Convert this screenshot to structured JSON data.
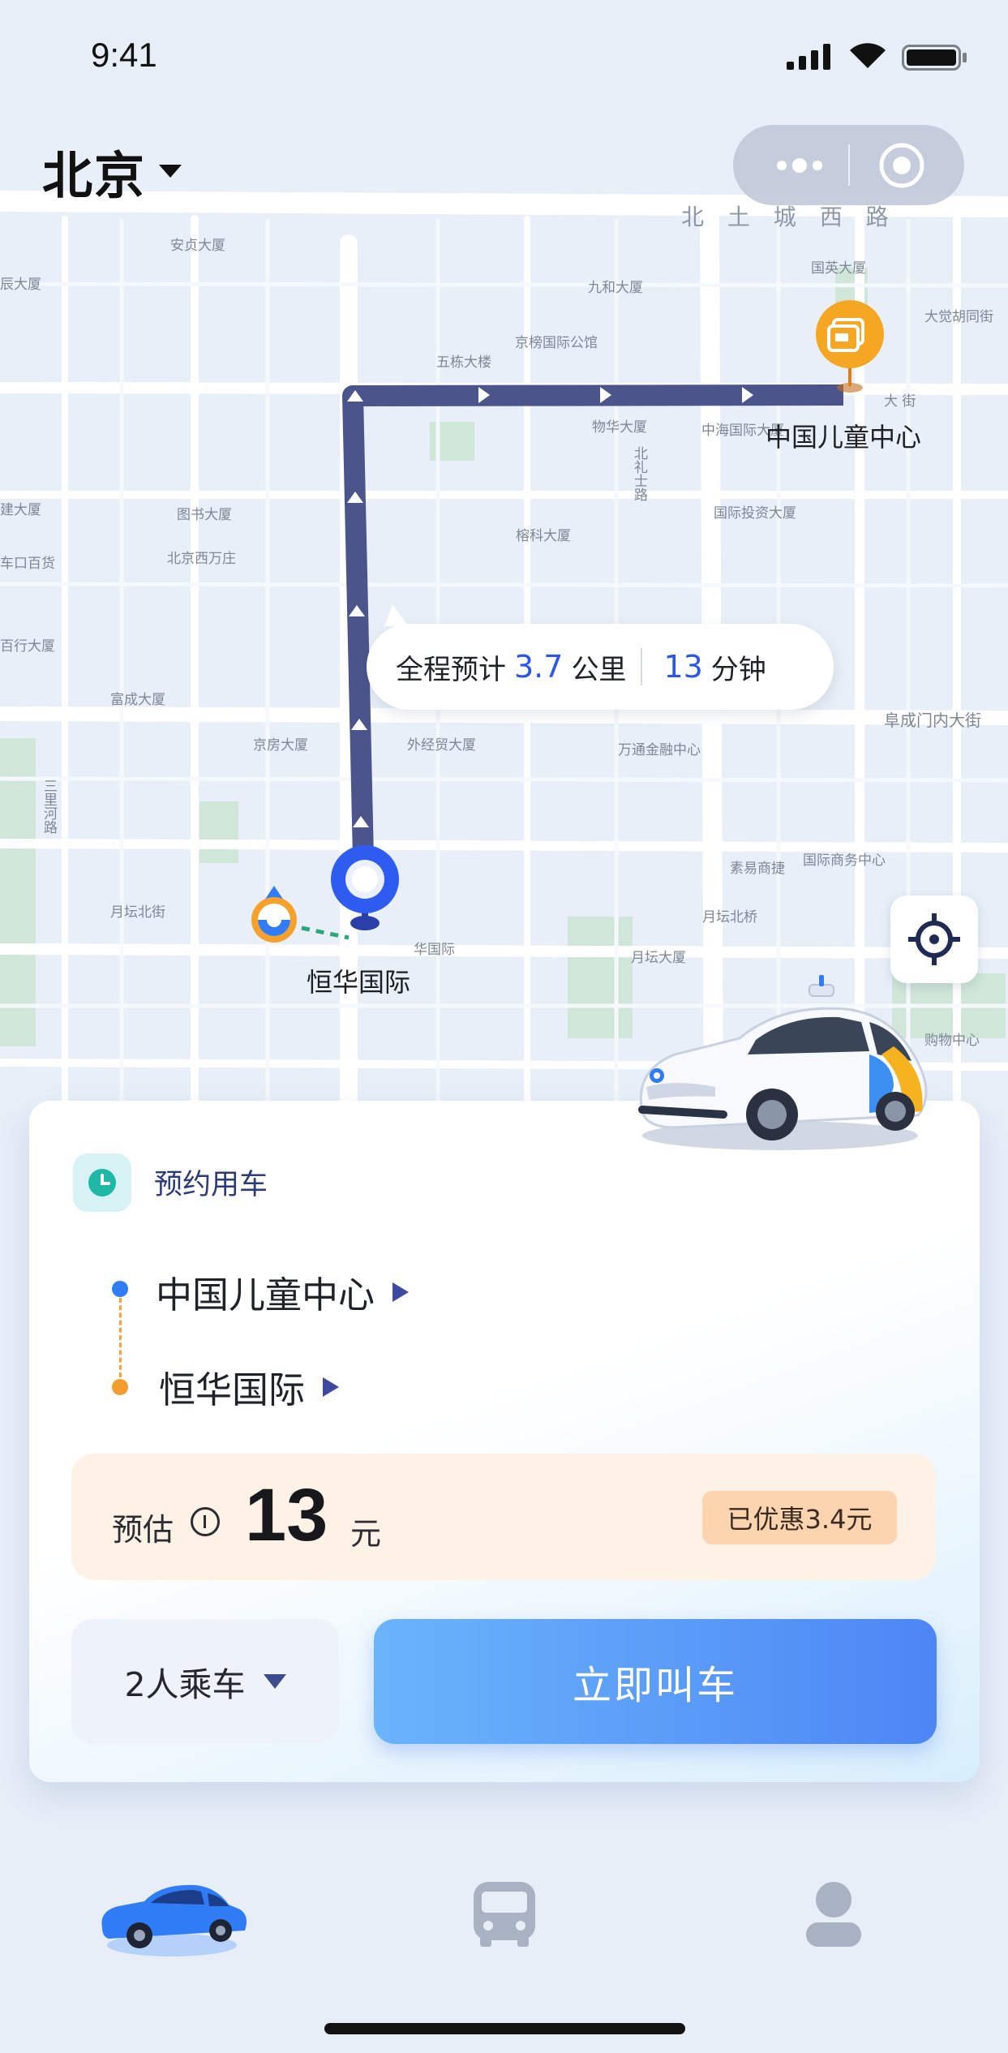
{
  "status_bar": {
    "time": "9:41"
  },
  "header": {
    "city": "北京"
  },
  "map": {
    "labels": {
      "north_road": "北 土 城 西 路",
      "anzhen": "安贞大厦",
      "left_edge_1": "辰大厦",
      "jiuhe": "九和大厦",
      "guoying": "国英大厦",
      "wudong": "五栋大楼",
      "jinglun": "京榜国际公馆",
      "tiantang": "大觉胡同街",
      "dajie": "大 街",
      "wuye": "物华大厦",
      "zhonghai": "中海国际大厦",
      "beilishi": "北礼士路",
      "guoji_touzi": "国际投资大厦",
      "left_edge_2": "建大厦",
      "tushu": "图书大厦",
      "rongke": "榕科大厦",
      "left_edge_3": "车口百货",
      "xiwanzhuang": "北京西万庄",
      "left_edge_4": "百行大厦",
      "fucheng": "富成大厦",
      "fuchengmen": "阜成门内大街",
      "jingfang": "京房大厦",
      "waijingmao": "外经贸大厦",
      "wantong": "万通金融中心",
      "sanlihe": "三里河路",
      "yuetan_north": "月坛北街",
      "guoji_shangwu": "国际商务中心",
      "suyuan": "素易商捷",
      "yuetan_bei": "月坛北桥",
      "hengguoji": "华国际",
      "yuetan_dasha": "月坛大厦",
      "gouwu": "购物中心"
    },
    "destination_poi": "中国儿童中心",
    "origin_poi": "恒华国际",
    "bubble": {
      "prefix": "全程预计",
      "distance": "3.7",
      "distance_unit": "公里",
      "duration": "13",
      "duration_unit": "分钟"
    }
  },
  "card": {
    "mode_label": "预约用车",
    "start": "中国儿童中心",
    "end": "恒华国际",
    "estimate_label": "预估",
    "price": "13",
    "price_unit": "元",
    "discount": "已优惠3.4元",
    "passengers": "2人乘车",
    "call_button": "立即叫车"
  },
  "colors": {
    "route": "#4b558c",
    "accent_blue": "#2b56e8",
    "button_start": "#6ab4fb",
    "button_end": "#4d86f5",
    "dest_marker": "#f5a623"
  },
  "tabs": [
    {
      "icon": "car-icon",
      "active": true
    },
    {
      "icon": "bus-icon",
      "active": false
    },
    {
      "icon": "user-icon",
      "active": false
    }
  ]
}
